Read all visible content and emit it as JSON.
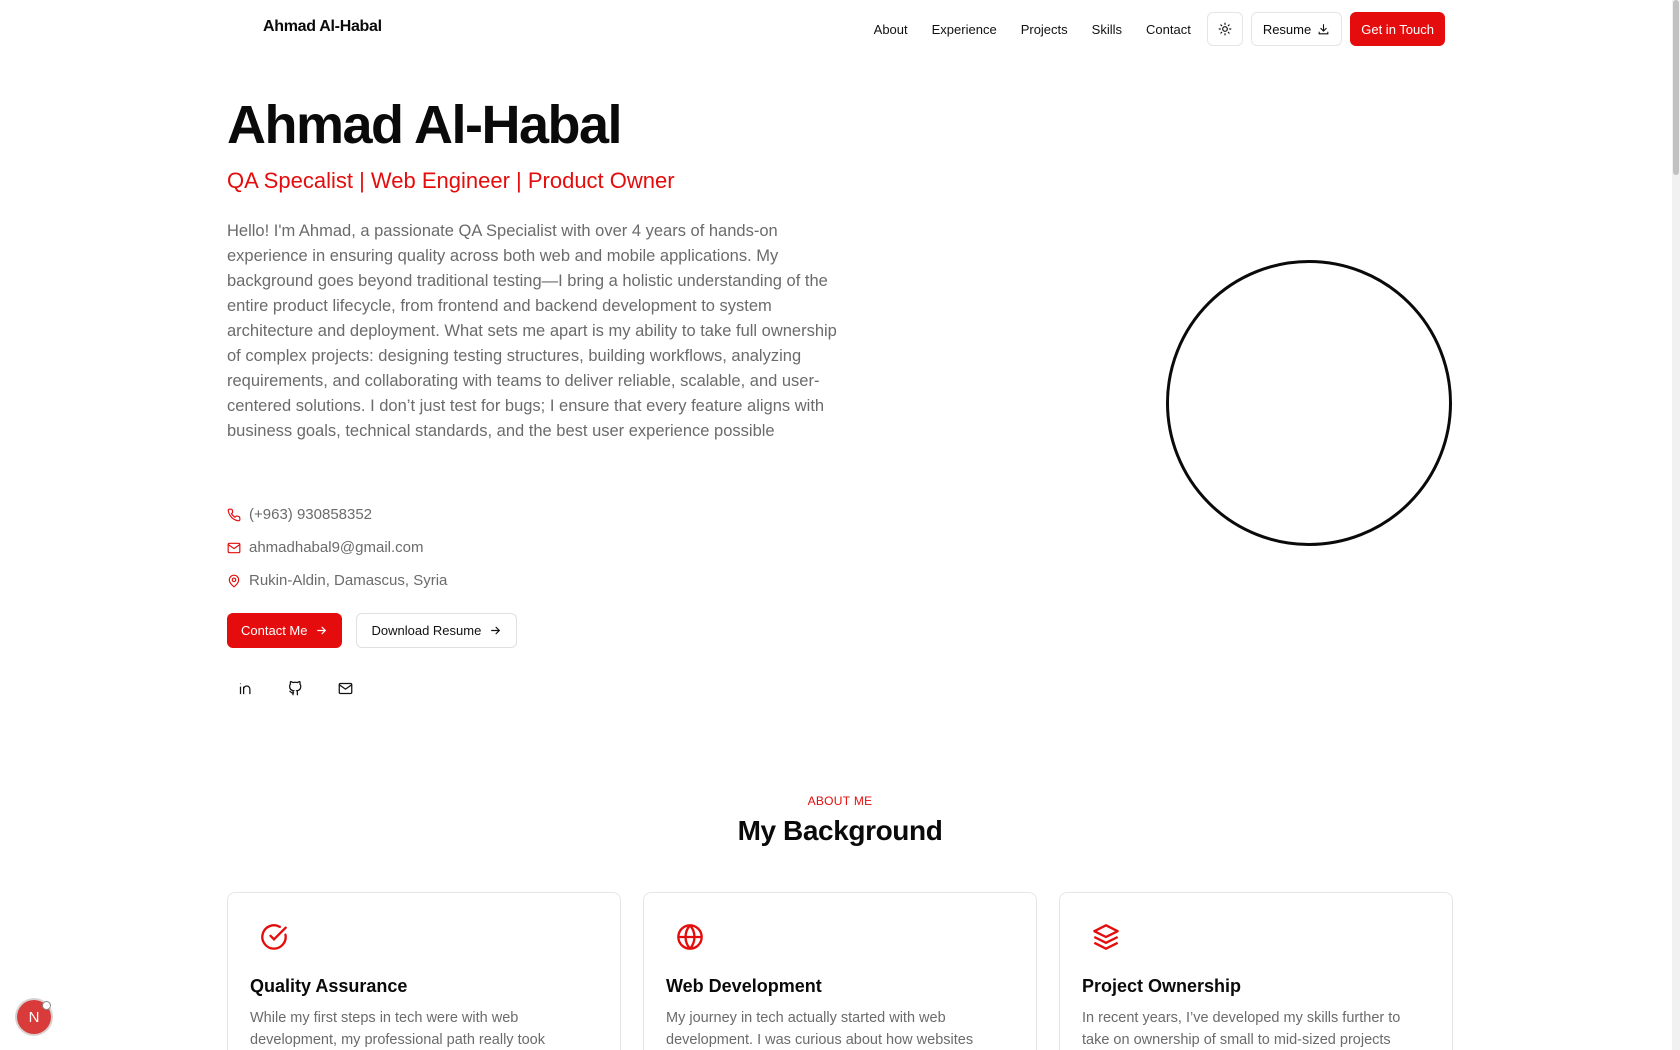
{
  "header": {
    "brand": "Ahmad Al-Habal",
    "nav": [
      "About",
      "Experience",
      "Projects",
      "Skills",
      "Contact"
    ],
    "theme_icon": "sun-icon",
    "resume_label": "Resume",
    "cta_label": "Get in Touch"
  },
  "hero": {
    "name": "Ahmad Al-Habal",
    "role": "QA Specalist | Web Engineer | Product Owner",
    "bio": "Hello! I'm Ahmad, a passionate QA Specialist with over 4 years of hands-on experience in ensuring quality across both web and mobile applications. My background goes beyond traditional testing—I bring a holistic understanding of the entire product lifecycle, from frontend and backend development to system architecture and deployment. What sets me apart is my ability to take full ownership of complex projects: designing testing structures, building workflows, analyzing requirements, and collaborating with teams to deliver reliable, scalable, and user-centered solutions. I don’t just test for bugs; I ensure that every feature aligns with business goals, technical standards, and the best user experience possible",
    "phone": "(+963) 930858352",
    "email": "ahmadhabal9@gmail.com",
    "location": "Rukin-Aldin, Damascus, Syria",
    "contact_button": "Contact Me",
    "download_button": "Download Resume"
  },
  "about": {
    "eyebrow": "ABOUT ME",
    "title": "My Background",
    "cards": [
      {
        "title": "Quality Assurance",
        "text": "While my first steps in tech were with web development, my professional path really took",
        "icon": "check-circle-icon"
      },
      {
        "title": "Web Development",
        "text": "My journey in tech actually started with web development. I was curious about how websites",
        "icon": "globe-icon"
      },
      {
        "title": "Project Ownership",
        "text": "In recent years, I’ve developed my skills further to take on ownership of small to mid-sized projects",
        "icon": "layers-icon"
      }
    ]
  },
  "dev_badge": "N",
  "colors": {
    "accent": "#e40c0c",
    "text_muted": "#6b6b6b"
  }
}
